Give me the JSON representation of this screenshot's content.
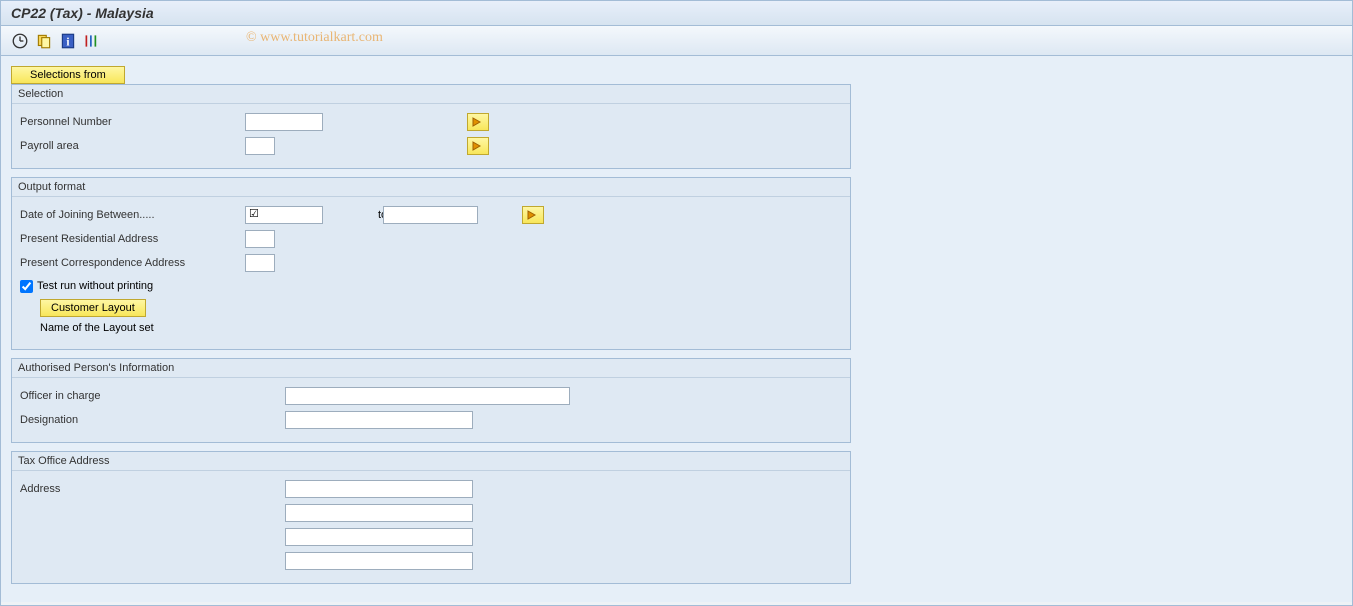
{
  "window": {
    "title": "CP22 (Tax) - Malaysia"
  },
  "watermark": "© www.tutorialkart.com",
  "toolbar": {
    "selections_from": "Selections from"
  },
  "groups": {
    "selection": {
      "title": "Selection",
      "personnel_number": "Personnel Number",
      "payroll_area": "Payroll area"
    },
    "output_format": {
      "title": "Output format",
      "date_joining": "Date of Joining Between.....",
      "to": "to",
      "present_residential": "Present Residential Address",
      "present_correspondence": "Present Correspondence Address",
      "test_run": "Test run without printing",
      "customer_layout": "Customer Layout",
      "layout_name": "Name of the Layout set"
    },
    "authorised": {
      "title": "Authorised Person's Information",
      "officer": "Officer in charge",
      "designation": "Designation"
    },
    "tax_office": {
      "title": "Tax Office Address",
      "address": "Address"
    }
  },
  "values": {
    "personnel_number": "",
    "payroll_area": "",
    "date_from": "",
    "date_from_marker": "☑",
    "date_to": "",
    "present_residential": "",
    "present_correspondence": "",
    "test_run_checked": true,
    "officer": "",
    "designation": "",
    "address1": "",
    "address2": "",
    "address3": "",
    "address4": ""
  }
}
